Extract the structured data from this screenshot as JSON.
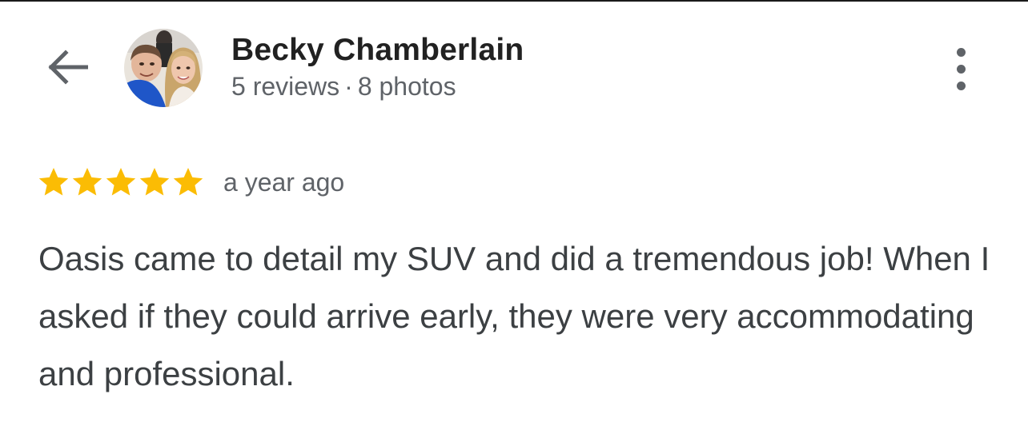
{
  "header": {
    "back_icon": "arrow-left-icon",
    "author_name": "Becky Chamberlain",
    "reviews_count": "5 reviews",
    "separator": "·",
    "photos_count": "8 photos",
    "more_icon": "more-vertical-icon"
  },
  "review": {
    "rating": 5,
    "max_rating": 5,
    "star_color": "#FBBC04",
    "date": "a year ago",
    "text": "Oasis came to detail my SUV and did a tremendous job! When I asked if they could arrive early, they were very accommodating and professional."
  },
  "colors": {
    "name": "#212121",
    "meta": "#5F6368",
    "body_text": "#3C4043",
    "icon": "#5F6368"
  }
}
